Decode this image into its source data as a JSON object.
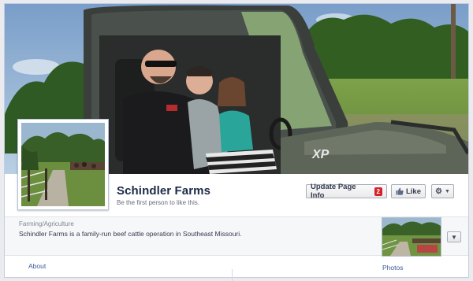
{
  "page": {
    "name": "Schindler Farms",
    "like_prompt": "Be the first person to like this.",
    "category": "Farming/Agriculture",
    "description": "Schindler Farms is a family-run beef cattle operation in Southeast Missouri."
  },
  "actions": {
    "update_label": "Update Page Info",
    "update_badge": "2",
    "like_label": "Like"
  },
  "nav": {
    "about_label": "About",
    "photos_label": "Photos"
  },
  "cover": {
    "vehicle_badge": "XP"
  },
  "icons": {
    "like": "thumbs-up-icon",
    "settings": "gear-icon",
    "dropdown": "caret-down-icon",
    "expand": "chevron-down-icon"
  },
  "colors": {
    "page_name": "#1c2a47",
    "link": "#3b5998",
    "badge": "#d6202a",
    "frame_border": "#c4cde0"
  }
}
